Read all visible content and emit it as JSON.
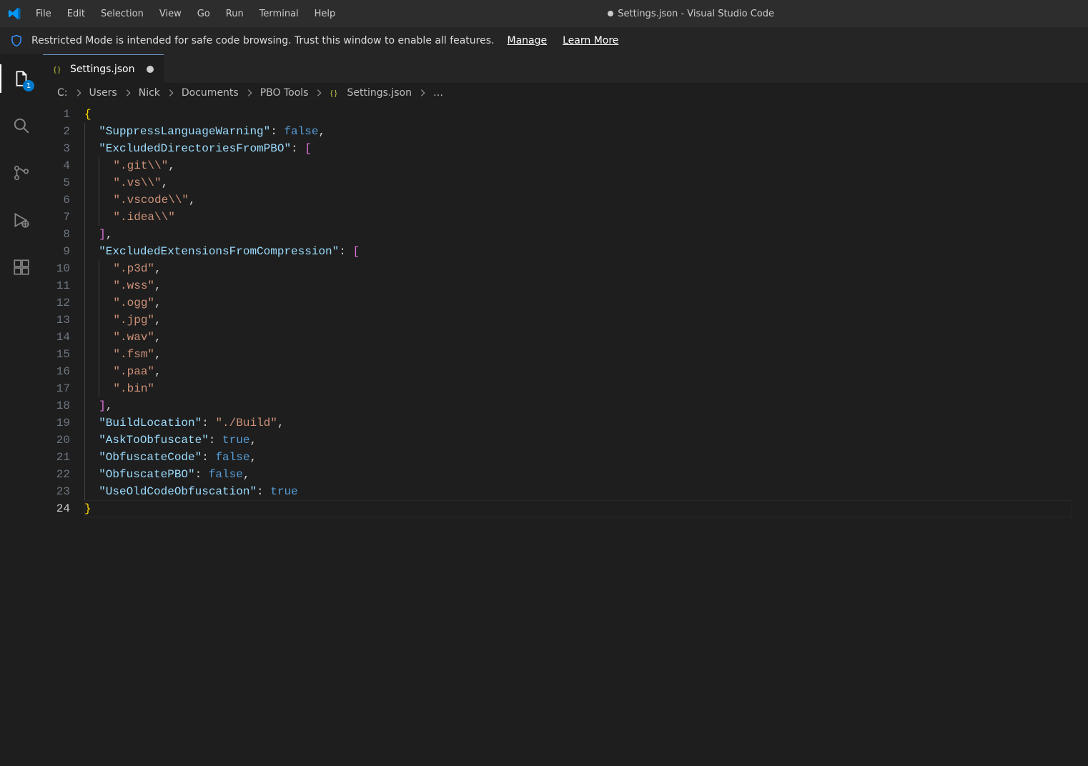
{
  "title": {
    "text": "Settings.json - Visual Studio Code",
    "dirty": true
  },
  "menus": [
    "File",
    "Edit",
    "Selection",
    "View",
    "Go",
    "Run",
    "Terminal",
    "Help"
  ],
  "notification": {
    "message": "Restricted Mode is intended for safe code browsing. Trust this window to enable all features.",
    "manage": "Manage",
    "learn_more": "Learn More"
  },
  "activity": {
    "explorer_badge": "1"
  },
  "tab": {
    "name": "Settings.json"
  },
  "breadcrumbs": {
    "parts": [
      "C:",
      "Users",
      "Nick",
      "Documents",
      "PBO Tools"
    ],
    "file": "Settings.json",
    "trailing": "…"
  },
  "code": {
    "line_count": 24,
    "current_line": 24,
    "keys": {
      "suppress": "SuppressLanguageWarning",
      "excl_dirs": "ExcludedDirectoriesFromPBO",
      "excl_ext": "ExcludedExtensionsFromCompression",
      "build_location": "BuildLocation",
      "ask_obfuscate": "AskToObfuscate",
      "obf_code": "ObfuscateCode",
      "obf_pbo": "ObfuscatePBO",
      "use_old": "UseOldCodeObfuscation"
    },
    "values": {
      "suppress": "false",
      "build_location": "./Build",
      "ask_obfuscate": "true",
      "obf_code": "false",
      "obf_pbo": "false",
      "use_old": "true"
    },
    "excluded_dirs": [
      ".git\\\\",
      ".vs\\\\",
      ".vscode\\\\",
      ".idea\\\\"
    ],
    "excluded_exts": [
      ".p3d",
      ".wss",
      ".ogg",
      ".jpg",
      ".wav",
      ".fsm",
      ".paa",
      ".bin"
    ]
  }
}
